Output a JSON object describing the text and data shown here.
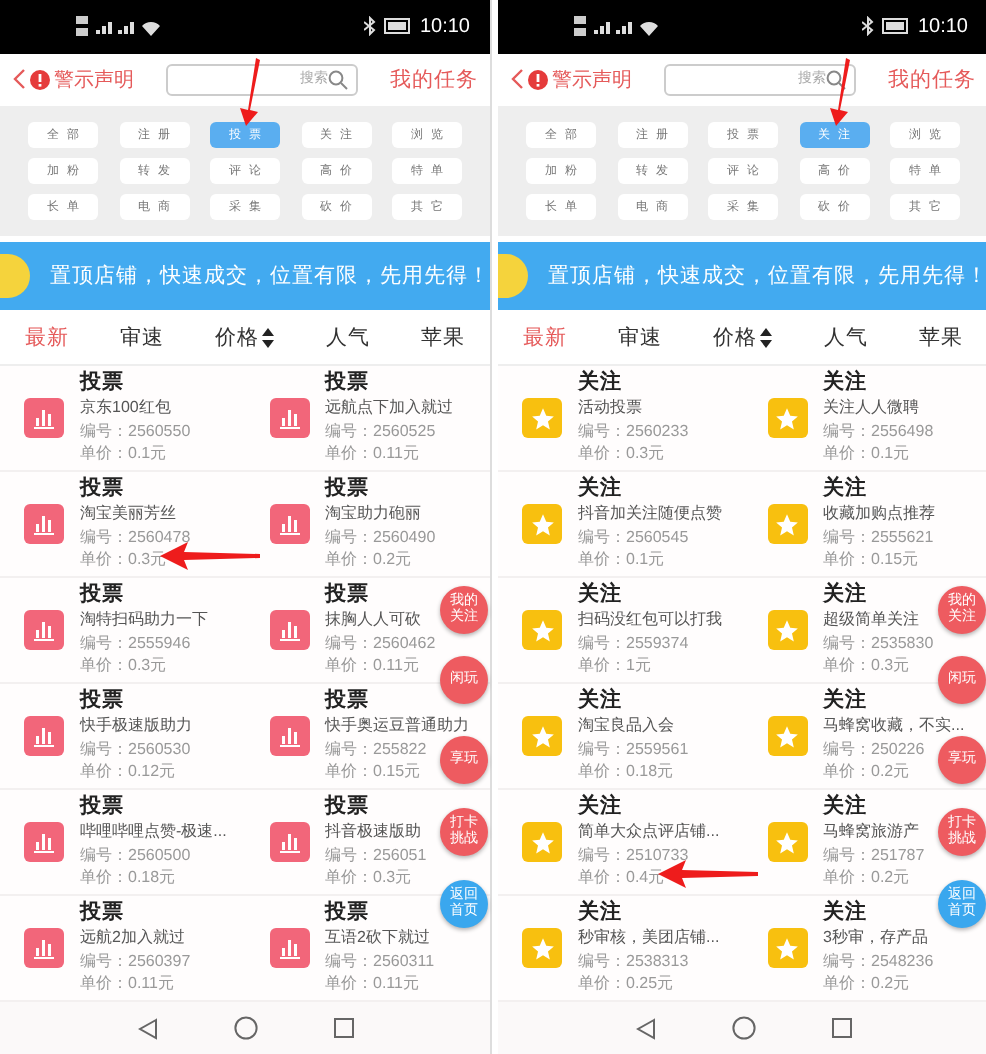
{
  "phones": [
    {
      "status_bar": {
        "time": "10:10"
      },
      "header": {
        "back_label": "警示声明",
        "search": {
          "placeholder": "搜索"
        },
        "action": "我的任务"
      },
      "categories": [
        {
          "label": "全部",
          "selected": false
        },
        {
          "label": "注册",
          "selected": false
        },
        {
          "label": "投票",
          "selected": true
        },
        {
          "label": "关注",
          "selected": false
        },
        {
          "label": "浏览",
          "selected": false
        },
        {
          "label": "加粉",
          "selected": false
        },
        {
          "label": "转发",
          "selected": false
        },
        {
          "label": "评论",
          "selected": false
        },
        {
          "label": "高价",
          "selected": false
        },
        {
          "label": "特单",
          "selected": false
        },
        {
          "label": "长单",
          "selected": false
        },
        {
          "label": "电商",
          "selected": false
        },
        {
          "label": "采集",
          "selected": false
        },
        {
          "label": "砍价",
          "selected": false
        },
        {
          "label": "其它",
          "selected": false
        }
      ],
      "banner": "置顶店铺，快速成交，位置有限，先用先得！",
      "sort_tabs": [
        {
          "label": "最新",
          "selected": true,
          "kind": "plain"
        },
        {
          "label": "审速",
          "selected": false,
          "kind": "plain"
        },
        {
          "label": "价格",
          "selected": false,
          "kind": "sort"
        },
        {
          "label": "人气",
          "selected": false,
          "kind": "plain"
        },
        {
          "label": "苹果",
          "selected": false,
          "kind": "plain"
        }
      ],
      "tasks": [
        {
          "kind": "chart",
          "type": "投票",
          "name": "京东100红包",
          "number": "编号：2560550",
          "price": "单价：0.1元",
          "highlighted": false
        },
        {
          "kind": "chart",
          "type": "投票",
          "name": "远航点下加入就过",
          "number": "编号：2560525",
          "price": "单价：0.11元",
          "highlighted": false
        },
        {
          "kind": "chart",
          "type": "投票",
          "name": "淘宝美丽芳丝",
          "number": "编号：2560478",
          "price": "单价：0.3元",
          "highlighted": true
        },
        {
          "kind": "chart",
          "type": "投票",
          "name": "淘宝助力砲丽",
          "number": "编号：2560490",
          "price": "单价：0.2元",
          "highlighted": false
        },
        {
          "kind": "chart",
          "type": "投票",
          "name": "淘特扫码助力一下",
          "number": "编号：2555946",
          "price": "单价：0.3元",
          "highlighted": false
        },
        {
          "kind": "chart",
          "type": "投票",
          "name": "抹胸人人可砍",
          "number": "编号：2560462",
          "price": "单价：0.11元",
          "highlighted": false
        },
        {
          "kind": "chart",
          "type": "投票",
          "name": "快手极速版助力",
          "number": "编号：2560530",
          "price": "单价：0.12元",
          "highlighted": false
        },
        {
          "kind": "chart",
          "type": "投票",
          "name": "快手奥运豆普通助力",
          "number": "编号：255822",
          "price": "单价：0.15元",
          "highlighted": false
        },
        {
          "kind": "chart",
          "type": "投票",
          "name": "哔哩哔哩点赞-极速...",
          "number": "编号：2560500",
          "price": "单价：0.18元",
          "highlighted": false
        },
        {
          "kind": "chart",
          "type": "投票",
          "name": "抖音极速版助",
          "number": "编号：256051",
          "price": "单价：0.3元",
          "highlighted": false
        },
        {
          "kind": "chart",
          "type": "投票",
          "name": "远航2加入就过",
          "number": "编号：2560397",
          "price": "单价：0.11元",
          "highlighted": false
        },
        {
          "kind": "chart",
          "type": "投票",
          "name": "互语2砍下就过",
          "number": "编号：2560311",
          "price": "单价：0.11元",
          "highlighted": false
        }
      ],
      "floating_buttons": [
        {
          "label": "我的关注",
          "color": "#ee5b60"
        },
        {
          "label": "闲玩",
          "color": "#ee5b60"
        },
        {
          "label": "享玩",
          "color": "#ee5b60"
        },
        {
          "label": "打卡挑战",
          "color": "#ee5b60"
        },
        {
          "label": "返回首页",
          "color": "#3aa7ee"
        }
      ]
    },
    {
      "status_bar": {
        "time": "10:10"
      },
      "header": {
        "back_label": "警示声明",
        "search": {
          "placeholder": "搜索"
        },
        "action": "我的任务"
      },
      "categories": [
        {
          "label": "全部",
          "selected": false
        },
        {
          "label": "注册",
          "selected": false
        },
        {
          "label": "投票",
          "selected": false
        },
        {
          "label": "关注",
          "selected": true
        },
        {
          "label": "浏览",
          "selected": false
        },
        {
          "label": "加粉",
          "selected": false
        },
        {
          "label": "转发",
          "selected": false
        },
        {
          "label": "评论",
          "selected": false
        },
        {
          "label": "高价",
          "selected": false
        },
        {
          "label": "特单",
          "selected": false
        },
        {
          "label": "长单",
          "selected": false
        },
        {
          "label": "电商",
          "selected": false
        },
        {
          "label": "采集",
          "selected": false
        },
        {
          "label": "砍价",
          "selected": false
        },
        {
          "label": "其它",
          "selected": false
        }
      ],
      "banner": "置顶店铺，快速成交，位置有限，先用先得！",
      "sort_tabs": [
        {
          "label": "最新",
          "selected": true,
          "kind": "plain"
        },
        {
          "label": "审速",
          "selected": false,
          "kind": "plain"
        },
        {
          "label": "价格",
          "selected": false,
          "kind": "sort"
        },
        {
          "label": "人气",
          "selected": false,
          "kind": "plain"
        },
        {
          "label": "苹果",
          "selected": false,
          "kind": "plain"
        }
      ],
      "tasks": [
        {
          "kind": "star",
          "type": "关注",
          "name": "活动投票",
          "number": "编号：2560233",
          "price": "单价：0.3元",
          "highlighted": false
        },
        {
          "kind": "star",
          "type": "关注",
          "name": "关注人人微聘",
          "number": "编号：2556498",
          "price": "单价：0.1元",
          "highlighted": false
        },
        {
          "kind": "star",
          "type": "关注",
          "name": "抖音加关注随便点赞",
          "number": "编号：2560545",
          "price": "单价：0.1元",
          "highlighted": false
        },
        {
          "kind": "star",
          "type": "关注",
          "name": "收藏加购点推荐",
          "number": "编号：2555621",
          "price": "单价：0.15元",
          "highlighted": false
        },
        {
          "kind": "star",
          "type": "关注",
          "name": "扫码没红包可以打我",
          "number": "编号：2559374",
          "price": "单价：1元",
          "highlighted": false
        },
        {
          "kind": "star",
          "type": "关注",
          "name": "超级简单关注",
          "number": "编号：2535830",
          "price": "单价：0.3元",
          "highlighted": false
        },
        {
          "kind": "star",
          "type": "关注",
          "name": "淘宝良品入会",
          "number": "编号：2559561",
          "price": "单价：0.18元",
          "highlighted": false
        },
        {
          "kind": "star",
          "type": "关注",
          "name": "马蜂窝收藏，不实...",
          "number": "编号：250226",
          "price": "单价：0.2元",
          "highlighted": false
        },
        {
          "kind": "star",
          "type": "关注",
          "name": "简单大众点评店铺...",
          "number": "编号：2510733",
          "price": "单价：0.4元",
          "highlighted": true
        },
        {
          "kind": "star",
          "type": "关注",
          "name": "马蜂窝旅游产",
          "number": "编号：251787",
          "price": "单价：0.2元",
          "highlighted": false
        },
        {
          "kind": "star",
          "type": "关注",
          "name": "秒审核，美团店铺...",
          "number": "编号：2538313",
          "price": "单价：0.25元",
          "highlighted": false
        },
        {
          "kind": "star",
          "type": "关注",
          "name": "3秒审，存产品",
          "number": "编号：2548236",
          "price": "单价：0.2元",
          "highlighted": false
        }
      ],
      "floating_buttons": [
        {
          "label": "我的关注",
          "color": "#ee5b60"
        },
        {
          "label": "闲玩",
          "color": "#ee5b60"
        },
        {
          "label": "享玩",
          "color": "#ee5b60"
        },
        {
          "label": "打卡挑战",
          "color": "#ee5b60"
        },
        {
          "label": "返回首页",
          "color": "#3aa7ee"
        }
      ]
    }
  ]
}
